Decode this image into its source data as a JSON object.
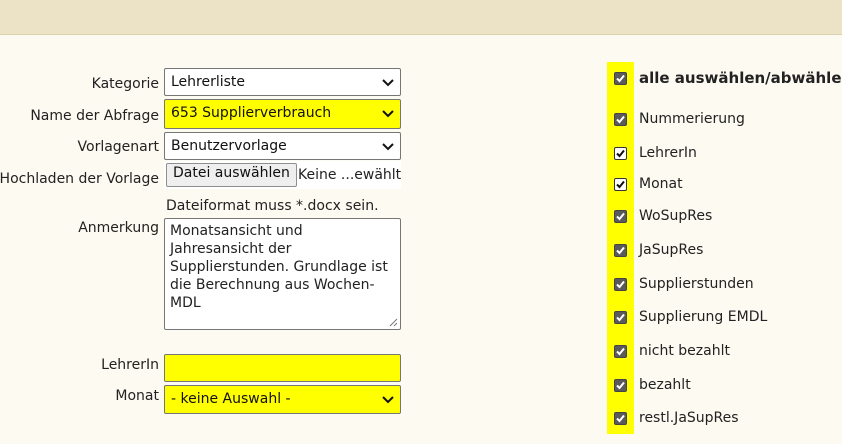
{
  "form": {
    "kategorie": {
      "label": "Kategorie",
      "value": "Lehrerliste"
    },
    "name_abfrage": {
      "label": "Name der Abfrage",
      "value": "653 Supplierverbrauch"
    },
    "vorlagenart": {
      "label": "Vorlagenart",
      "value": "Benutzervorlage"
    },
    "upload": {
      "label": "Hochladen der Vorlage",
      "button": "Datei auswählen",
      "status": "Keine ...ewählt"
    },
    "hint": "Dateiformat muss *.docx sein.",
    "anmerkung": {
      "label": "Anmerkung",
      "value": "Monatsansicht und Jahresansicht der Supplierstunden. Grundlage ist die Berechnung aus Wochen-MDL"
    },
    "lehrerin": {
      "label": "LehrerIn",
      "value": ""
    },
    "monat": {
      "label": "Monat",
      "value": "- keine Auswahl -"
    }
  },
  "checkboxes": {
    "select_all": "alle auswählen/abwählen",
    "items": [
      {
        "label": "Nummerierung",
        "checked": true
      },
      {
        "label": "LehrerIn",
        "checked": true
      },
      {
        "label": "Monat",
        "checked": true
      },
      {
        "label": "WoSupRes",
        "checked": true
      },
      {
        "label": "JaSupRes",
        "checked": true
      },
      {
        "label": "Supplierstunden",
        "checked": true
      },
      {
        "label": "Supplierung EMDL",
        "checked": true
      },
      {
        "label": "nicht bezahlt",
        "checked": true
      },
      {
        "label": "bezahlt",
        "checked": true
      },
      {
        "label": "restl.JaSupRes",
        "checked": true
      }
    ]
  },
  "colors": {
    "header_band": "#ece3c6",
    "highlight": "#ffff00",
    "background": "#fdfaf2"
  }
}
